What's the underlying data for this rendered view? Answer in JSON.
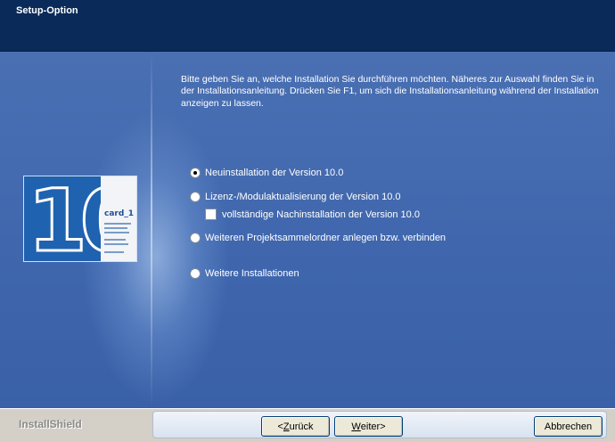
{
  "window": {
    "title": "Setup-Option"
  },
  "intro_text": "Bitte geben Sie an, welche Installation Sie durchführen möchten. Näheres zur Auswahl finden Sie in der Installationsanleitung. Drücken Sie F1, um sich die Installationsanleitung während der Installation anzeigen zu lassen.",
  "options": {
    "new_install": {
      "label": "Neuinstallation der Version 10.0",
      "selected": true
    },
    "license_update": {
      "label": "Lizenz-/Modulaktualisierung der Version 10.0",
      "selected": false
    },
    "full_reinstall": {
      "label": "vollständige Nachinstallation der Version 10.0",
      "checked": false
    },
    "project_folder": {
      "label": "Weiteren Projektsammelordner anlegen bzw. verbinden",
      "selected": false
    },
    "more_installs": {
      "label": "Weitere Installationen",
      "selected": false
    }
  },
  "logo": {
    "number": "10",
    "brand": "card_1"
  },
  "footer": {
    "brand": "InstallShield"
  },
  "buttons": {
    "back": {
      "prefix": "< ",
      "mnemonic": "Z",
      "rest": "urück"
    },
    "next": {
      "mnemonic": "W",
      "rest": "eiter",
      "suffix": " >"
    },
    "cancel": "Abbrechen"
  },
  "colors": {
    "title_bar": "#0a2a5a",
    "content_bg": "#3d63a6",
    "footer_bg": "#d4d0c8"
  }
}
